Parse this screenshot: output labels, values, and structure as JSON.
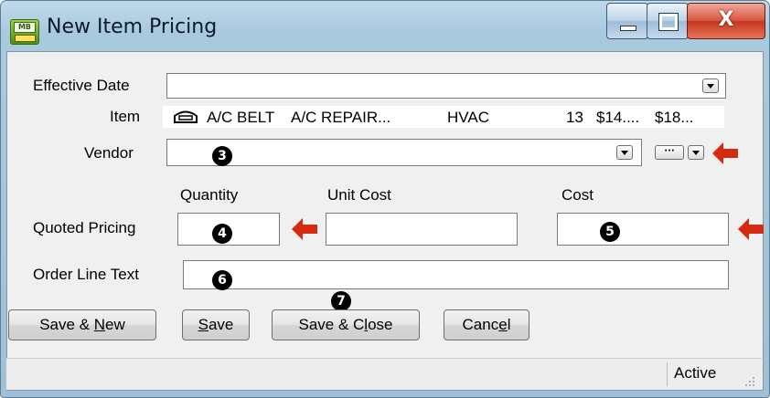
{
  "window": {
    "title": "New Item Pricing",
    "app_icon_text": "MB"
  },
  "form": {
    "effective_date": {
      "label": "Effective Date",
      "value": ""
    },
    "item": {
      "label": "Item",
      "icon": "item-icon",
      "cells": [
        "A/C BELT",
        "A/C  REPAIR...",
        "HVAC",
        "13",
        "$14....",
        "$18..."
      ]
    },
    "vendor": {
      "label": "Vendor",
      "value": "",
      "marker": "3"
    },
    "column_headers": {
      "quantity": "Quantity",
      "unit_cost": "Unit Cost",
      "cost": "Cost"
    },
    "quoted_pricing": {
      "label": "Quoted Pricing",
      "quantity": "",
      "unit_cost": "",
      "cost": "",
      "quantity_marker": "4",
      "cost_marker": "5"
    },
    "order_line_text": {
      "label": "Order Line Text",
      "value": "",
      "marker": "6"
    }
  },
  "buttons": {
    "save_new_pre": "Save & ",
    "save_new_u": "N",
    "save_new_post": "ew",
    "save_u": "S",
    "save_post": "ave",
    "save_close_pre": "Save & C",
    "save_close_u": "l",
    "save_close_post": "ose",
    "cancel_pre": "Canc",
    "cancel_u": "e",
    "cancel_post": "l",
    "marker": "7"
  },
  "status": {
    "text": "Active"
  },
  "colors": {
    "arrow": "#d62a10",
    "close_button": "#c7371f"
  }
}
